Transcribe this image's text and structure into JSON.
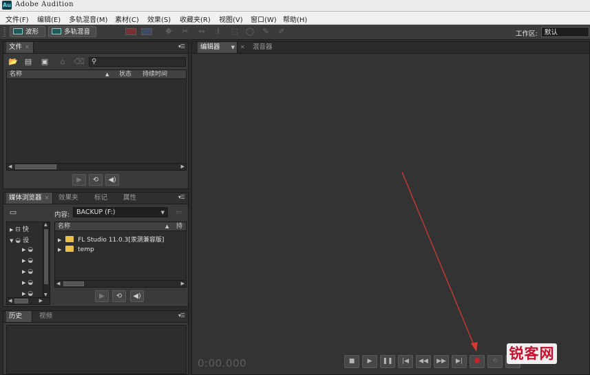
{
  "app": {
    "logo_text": "Au",
    "title": "Adobe Audition"
  },
  "menu": [
    {
      "label": "文件(F)"
    },
    {
      "label": "编辑(E)"
    },
    {
      "label": "多轨混音(M)"
    },
    {
      "label": "素材(C)"
    },
    {
      "label": "效果(S)"
    },
    {
      "label": "收藏夹(R)"
    },
    {
      "label": "视图(V)"
    },
    {
      "label": "窗口(W)"
    },
    {
      "label": "帮助(H)"
    }
  ],
  "toolbar": {
    "waveform_label": "波形",
    "multitrack_label": "多轨混音",
    "workspace_label": "工作区:",
    "workspace_value": "默认"
  },
  "files_panel": {
    "tab": "文件",
    "columns": {
      "name": "名称",
      "status": "状态",
      "duration": "持续时间"
    }
  },
  "media_browser": {
    "tabs": [
      "媒体浏览器",
      "效果夹",
      "标记",
      "属性"
    ],
    "content_label": "内容:",
    "content_value": "BACKUP (F:)",
    "tree": [
      "快",
      "设"
    ],
    "columns": {
      "name": "名称",
      "duration": "持"
    },
    "items": [
      {
        "name": "FL Studio 11.0.3[汞测兼容版]"
      },
      {
        "name": "temp"
      }
    ]
  },
  "history_panel": {
    "tabs": [
      "历史",
      "视频"
    ]
  },
  "editor": {
    "tabs": [
      "编辑器",
      "混音器"
    ],
    "time": "0:00.000"
  },
  "watermark": "锐客网",
  "colors": {
    "accent_record": "#c1272d",
    "annotation_arrow": "#d23a32",
    "workspace_bg": "#2b2b2b"
  }
}
